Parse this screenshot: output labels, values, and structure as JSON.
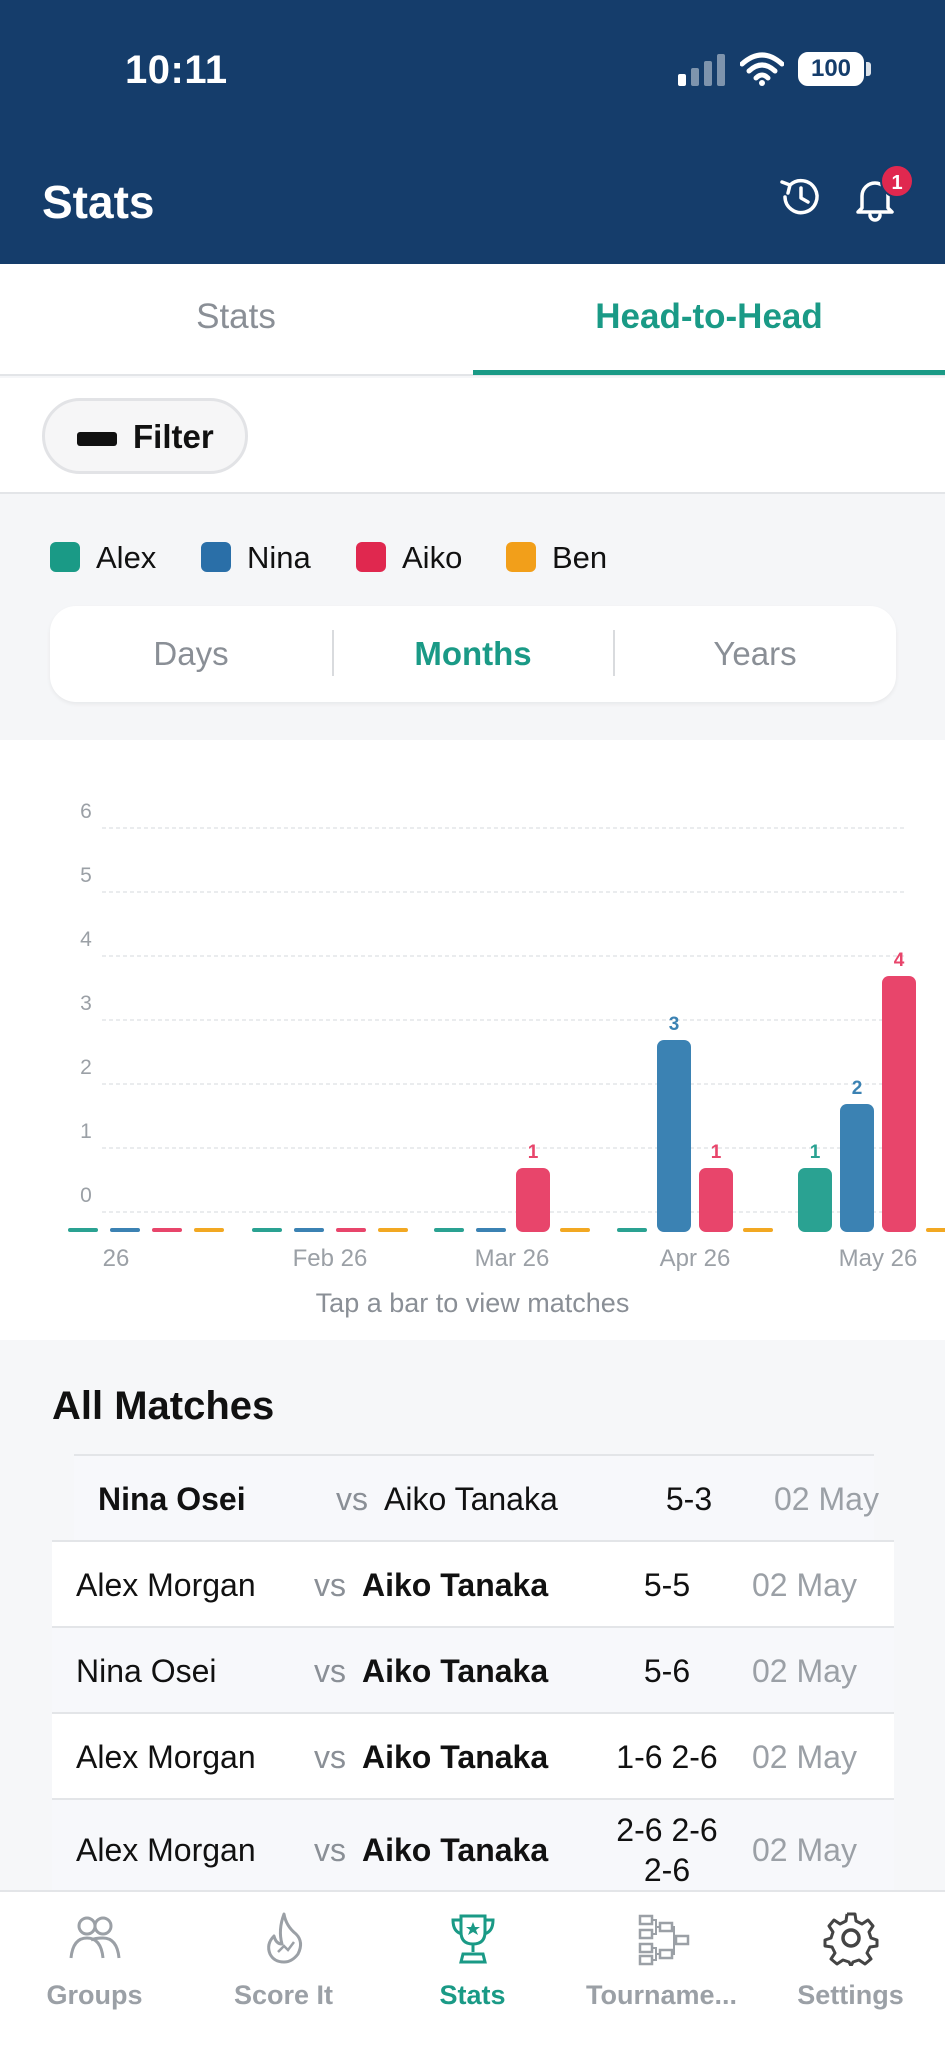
{
  "status": {
    "time": "10:11",
    "battery": "100"
  },
  "header": {
    "title": "Stats",
    "notification_count": "1"
  },
  "tabs": [
    {
      "label": "Stats"
    },
    {
      "label": "Head-to-Head"
    }
  ],
  "filter": {
    "label": "Filter"
  },
  "legend": [
    {
      "name": "Alex",
      "color": "#1a9a86"
    },
    {
      "name": "Nina",
      "color": "#2a6fa8"
    },
    {
      "name": "Aiko",
      "color": "#e0284f"
    },
    {
      "name": "Ben",
      "color": "#f29f1a"
    }
  ],
  "granularity": {
    "options": [
      "Days",
      "Months",
      "Years"
    ],
    "selected": "Months"
  },
  "chart_data": {
    "type": "bar",
    "categories": [
      "26",
      "Feb 26",
      "Mar 26",
      "Apr 26",
      "May 26"
    ],
    "series": [
      {
        "name": "Alex",
        "color": "#2aa292",
        "values": [
          0,
          0,
          0,
          0,
          1
        ]
      },
      {
        "name": "Nina",
        "color": "#3b82b3",
        "values": [
          0,
          0,
          0,
          3,
          2
        ]
      },
      {
        "name": "Aiko",
        "color": "#e8456b",
        "values": [
          0,
          0,
          1,
          1,
          4
        ]
      },
      {
        "name": "Ben",
        "color": "#f2a822",
        "values": [
          0,
          0,
          0,
          0,
          0
        ]
      }
    ],
    "y_tick_labels": [
      "0",
      "1",
      "2",
      "3",
      "4",
      "5",
      "6"
    ],
    "ylim": [
      0,
      6
    ],
    "grid": true,
    "hint": "Tap a bar to view matches"
  },
  "matches": {
    "title": "All Matches",
    "vs_label": "vs",
    "rows": [
      {
        "player1": "Nina Osei",
        "player2": "Aiko Tanaka",
        "winner": 1,
        "score": "5-3",
        "date": "02 May"
      },
      {
        "player1": "Alex Morgan",
        "player2": "Aiko Tanaka",
        "winner": 2,
        "score": "5-5",
        "date": "02 May"
      },
      {
        "player1": "Nina Osei",
        "player2": "Aiko Tanaka",
        "winner": 2,
        "score": "5-6",
        "date": "02 May"
      },
      {
        "player1": "Alex Morgan",
        "player2": "Aiko Tanaka",
        "winner": 2,
        "score": "1-6 2-6",
        "date": "02 May"
      },
      {
        "player1": "Alex Morgan",
        "player2": "Aiko Tanaka",
        "winner": 2,
        "score": "2-6 2-6 2-6",
        "date": "02 May"
      }
    ]
  },
  "nav": [
    {
      "label": "Groups",
      "icon": "groups-icon"
    },
    {
      "label": "Score It",
      "icon": "flame-icon"
    },
    {
      "label": "Stats",
      "icon": "trophy-icon",
      "active": true
    },
    {
      "label": "Tourname...",
      "icon": "bracket-icon"
    },
    {
      "label": "Settings",
      "icon": "gear-icon"
    }
  ]
}
